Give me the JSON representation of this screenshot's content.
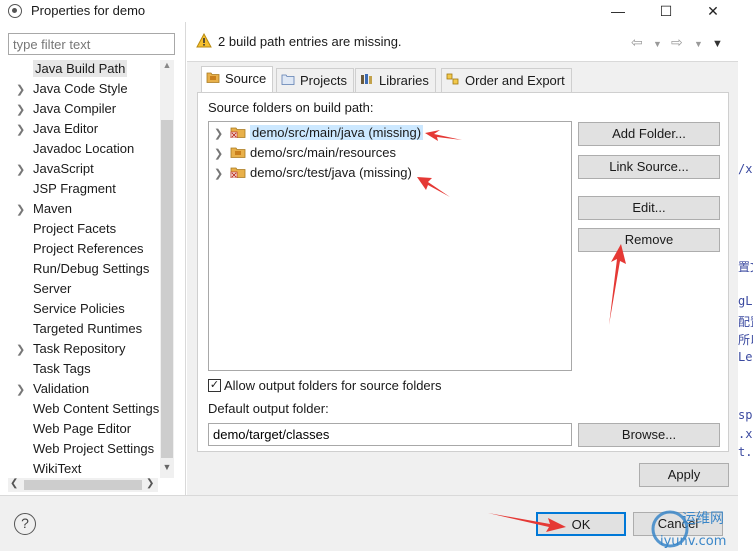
{
  "window": {
    "title": "Properties for demo",
    "controls": [
      "—",
      "☐",
      "✕"
    ]
  },
  "filter": {
    "placeholder": "type filter text"
  },
  "sidebar": {
    "items": [
      {
        "label": "Java Build Path",
        "expandable": false,
        "selected": true
      },
      {
        "label": "Java Code Style",
        "expandable": true
      },
      {
        "label": "Java Compiler",
        "expandable": true
      },
      {
        "label": "Java Editor",
        "expandable": true
      },
      {
        "label": "Javadoc Location",
        "expandable": false
      },
      {
        "label": "JavaScript",
        "expandable": true
      },
      {
        "label": "JSP Fragment",
        "expandable": false
      },
      {
        "label": "Maven",
        "expandable": true
      },
      {
        "label": "Project Facets",
        "expandable": false
      },
      {
        "label": "Project References",
        "expandable": false
      },
      {
        "label": "Run/Debug Settings",
        "expandable": false
      },
      {
        "label": "Server",
        "expandable": false
      },
      {
        "label": "Service Policies",
        "expandable": false
      },
      {
        "label": "Targeted Runtimes",
        "expandable": false
      },
      {
        "label": "Task Repository",
        "expandable": true
      },
      {
        "label": "Task Tags",
        "expandable": false
      },
      {
        "label": "Validation",
        "expandable": true
      },
      {
        "label": "Web Content Settings",
        "expandable": false
      },
      {
        "label": "Web Page Editor",
        "expandable": false
      },
      {
        "label": "Web Project Settings",
        "expandable": false
      },
      {
        "label": "WikiText",
        "expandable": false
      }
    ]
  },
  "message": {
    "text": "2 build path entries are missing.",
    "icon": "warning-icon"
  },
  "tabs": [
    {
      "label": "Source",
      "icon": "source-icon",
      "active": true
    },
    {
      "label": "Projects",
      "icon": "projects-icon"
    },
    {
      "label": "Libraries",
      "icon": "libraries-icon"
    },
    {
      "label": "Order and Export",
      "icon": "order-export-icon"
    }
  ],
  "source": {
    "label": "Source folders on build path:",
    "folders": [
      {
        "label": "demo/src/main/java (missing)",
        "missing": true,
        "selected": true
      },
      {
        "label": "demo/src/main/resources",
        "missing": false
      },
      {
        "label": "demo/src/test/java (missing)",
        "missing": true
      }
    ],
    "buttons": {
      "add_folder": "Add Folder...",
      "link_source": "Link Source...",
      "edit": "Edit...",
      "remove": "Remove"
    },
    "allow_output_label": "Allow output folders for source folders",
    "allow_output_checked": true,
    "default_output_label": "Default output folder:",
    "default_output_value": "demo/target/classes",
    "browse": "Browse..."
  },
  "apply": "Apply",
  "ok": "OK",
  "cancel": "Cancel",
  "watermark": {
    "cn": "运维网",
    "en": "iyunv.com"
  },
  "background_fragments": [
    "/x",
    "置文",
    "gLo",
    "配置",
    "所以",
    "Lef",
    "sp",
    ".x",
    "t."
  ],
  "colors": {
    "selection": "#cce8ff",
    "arrow": "#e53935",
    "panel": "#f0f0f0",
    "ok_border": "#0078d7"
  }
}
